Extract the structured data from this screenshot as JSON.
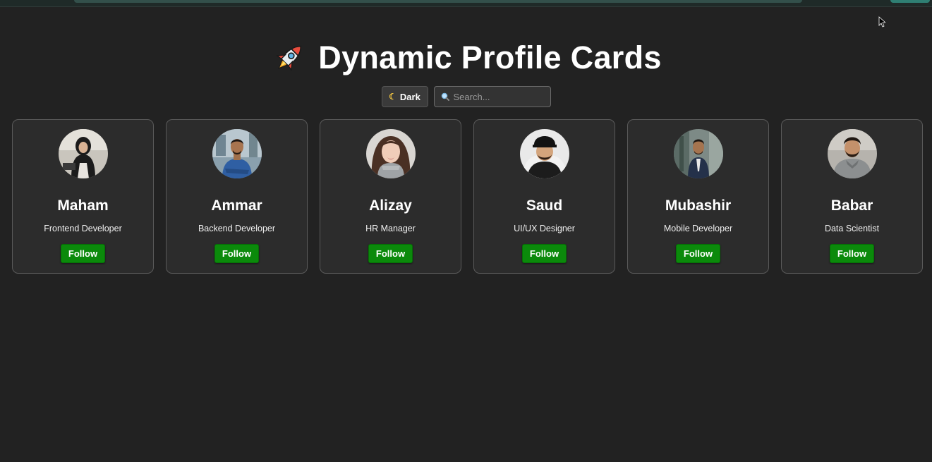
{
  "header": {
    "title": "Dynamic Profile Cards",
    "icon": "rocket-icon"
  },
  "controls": {
    "theme_label": "Dark",
    "theme_icon": "moon-icon",
    "search_placeholder": "Search...",
    "search_value": ""
  },
  "colors": {
    "background": "#222222",
    "card_background": "#2c2c2c",
    "follow_button": "#0b8a0b"
  },
  "profiles": [
    {
      "name": "Maham",
      "role": "Frontend Developer",
      "button": "Follow"
    },
    {
      "name": "Ammar",
      "role": "Backend Developer",
      "button": "Follow"
    },
    {
      "name": "Alizay",
      "role": "HR Manager",
      "button": "Follow"
    },
    {
      "name": "Saud",
      "role": "UI/UX Designer",
      "button": "Follow"
    },
    {
      "name": "Mubashir",
      "role": "Mobile Developer",
      "button": "Follow"
    },
    {
      "name": "Babar",
      "role": "Data Scientist",
      "button": "Follow"
    }
  ]
}
